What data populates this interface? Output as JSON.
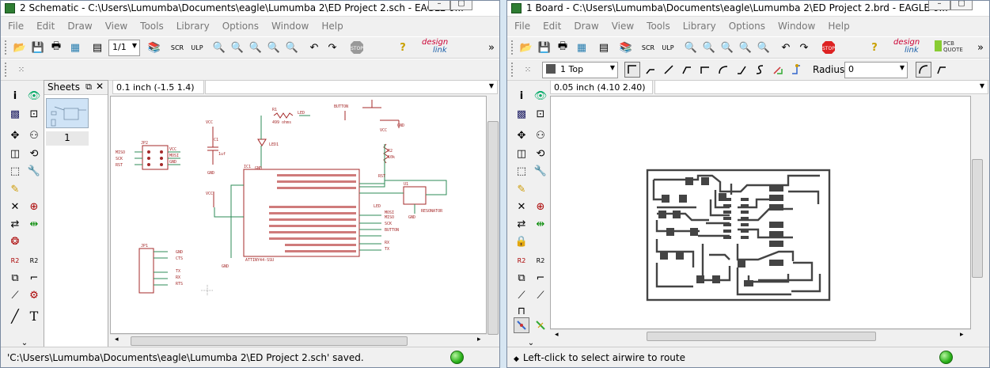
{
  "schematic": {
    "title": "2 Schematic - C:\\Users\\Lumumba\\Documents\\eagle\\Lumumba 2\\ED Project 2.sch - EAGLE 6...",
    "menu": [
      "File",
      "Edit",
      "Draw",
      "View",
      "Tools",
      "Library",
      "Options",
      "Window",
      "Help"
    ],
    "sheet_combo": "1/1",
    "sheets_label": "Sheets",
    "sheet_number": "1",
    "coord": "0.1 inch (-1.5 1.4)",
    "status": "'C:\\Users\\Lumumba\\Documents\\eagle\\Lumumba 2\\ED Project 2.sch' saved.",
    "labels": {
      "r1": "R1",
      "r1_val": "499 ohms",
      "led_top": "LED",
      "led1": "LED1",
      "button": "BUTTON",
      "vcc": "VCC",
      "gnd": "GND",
      "c1": "C1",
      "c1_val": "1uf",
      "jp2": "JP2",
      "ic1": "IC1",
      "r2": "R2",
      "r2_val": "10k",
      "rst": "RST",
      "u1": "U1",
      "resonator": "RESONATOR",
      "chip": "ATTINY44-SSU",
      "jp1": "JP1",
      "miso": "MISO",
      "sck": "SCK",
      "mosi": "MOSI",
      "cts": "CTS",
      "tx": "TX",
      "rx": "RX",
      "rts": "RTS",
      "led_net": "LED",
      "button_net": "BUTTON"
    }
  },
  "board": {
    "title": "1 Board - C:\\Users\\Lumumba\\Documents\\eagle\\Lumumba 2\\ED Project 2.brd - EAGLE 6...",
    "menu": [
      "File",
      "Edit",
      "Draw",
      "View",
      "Tools",
      "Library",
      "Options",
      "Window",
      "Help"
    ],
    "layer": "1 Top",
    "radius_label": "Radius:",
    "radius_value": "0",
    "coord": "0.05 inch (4.10 2.40)",
    "status": "Left-click to select airwire to route"
  },
  "brand": {
    "design": "design",
    "link": "link",
    "pcb": "PCB",
    "quote": "QUOTE"
  },
  "colors": {
    "schematic_line": "#a52a2a",
    "net_green": "#2e8b57",
    "accent": "#2e7d32"
  }
}
